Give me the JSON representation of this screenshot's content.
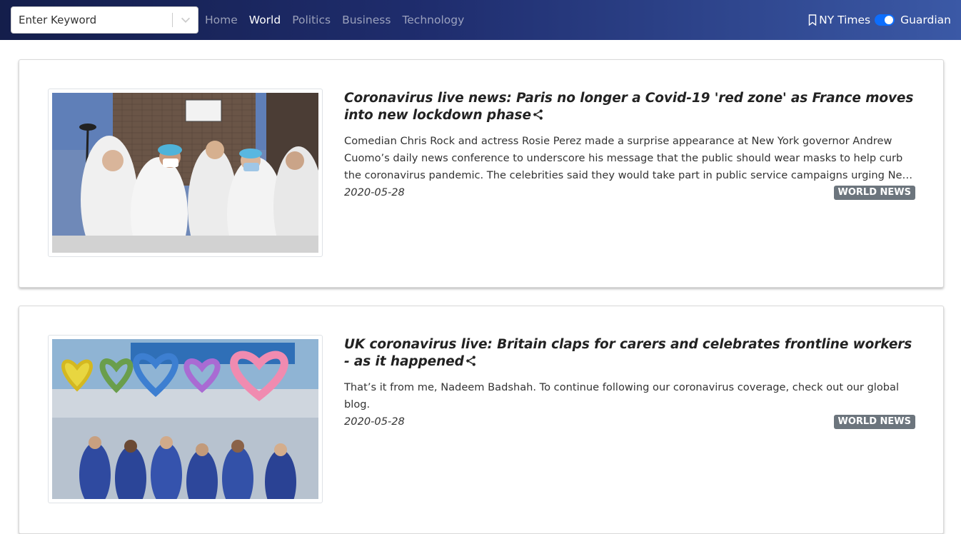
{
  "search": {
    "placeholder": "Enter Keyword"
  },
  "nav": {
    "links": [
      "Home",
      "World",
      "Politics",
      "Business",
      "Technology"
    ],
    "active": "World",
    "source_left": "NY Times",
    "source_right": "Guardian"
  },
  "colors": {
    "accent": "#0d6efd",
    "badge": "#6c757d"
  },
  "articles": [
    {
      "title": "Coronavirus live news: Paris no longer a Covid-19 'red zone' as France moves into new lockdown phase",
      "description": "Comedian Chris Rock and actress Rosie Perez made a surprise appearance at New York governor Andrew Cuomo’s daily news conference to underscore his message that the public should wear masks to help curb the coronavirus pandemic. The celebrities said they would take part in public service campaigns urging New Yorkers to wear face coverings.",
      "date": "2020-05-28",
      "section": "WORLD NEWS"
    },
    {
      "title": "UK coronavirus live: Britain claps for carers and celebrates frontline workers - as it happened",
      "description": "That’s it from me, Nadeem Badshah. To continue following our coronavirus coverage, check out our global blog.",
      "date": "2020-05-28",
      "section": "WORLD NEWS"
    }
  ]
}
